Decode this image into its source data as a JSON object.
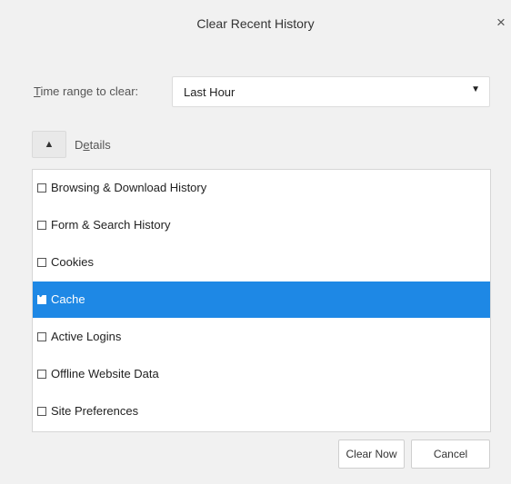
{
  "dialog": {
    "title": "Clear Recent History",
    "close_glyph": "×"
  },
  "time_range": {
    "label_mnemonic": "T",
    "label_rest": "ime range to clear:",
    "selected": "Last Hour",
    "arrow_glyph": "▼"
  },
  "details": {
    "toggle_glyph": "▲",
    "label_start": "D",
    "label_mnemonic": "e",
    "label_rest": "tails",
    "expanded": true
  },
  "items": [
    {
      "label": "Browsing & Download History",
      "checked": false
    },
    {
      "label": "Form & Search History",
      "checked": false
    },
    {
      "label": "Cookies",
      "checked": false
    },
    {
      "label": "Cache",
      "checked": true
    },
    {
      "label": "Active Logins",
      "checked": false
    },
    {
      "label": "Offline Website Data",
      "checked": false
    },
    {
      "label": "Site Preferences",
      "checked": false
    }
  ],
  "buttons": {
    "clear_now": "Clear Now",
    "cancel": "Cancel"
  },
  "colors": {
    "selection": "#1e88e5",
    "dialog_bg": "#f1f1f1"
  }
}
